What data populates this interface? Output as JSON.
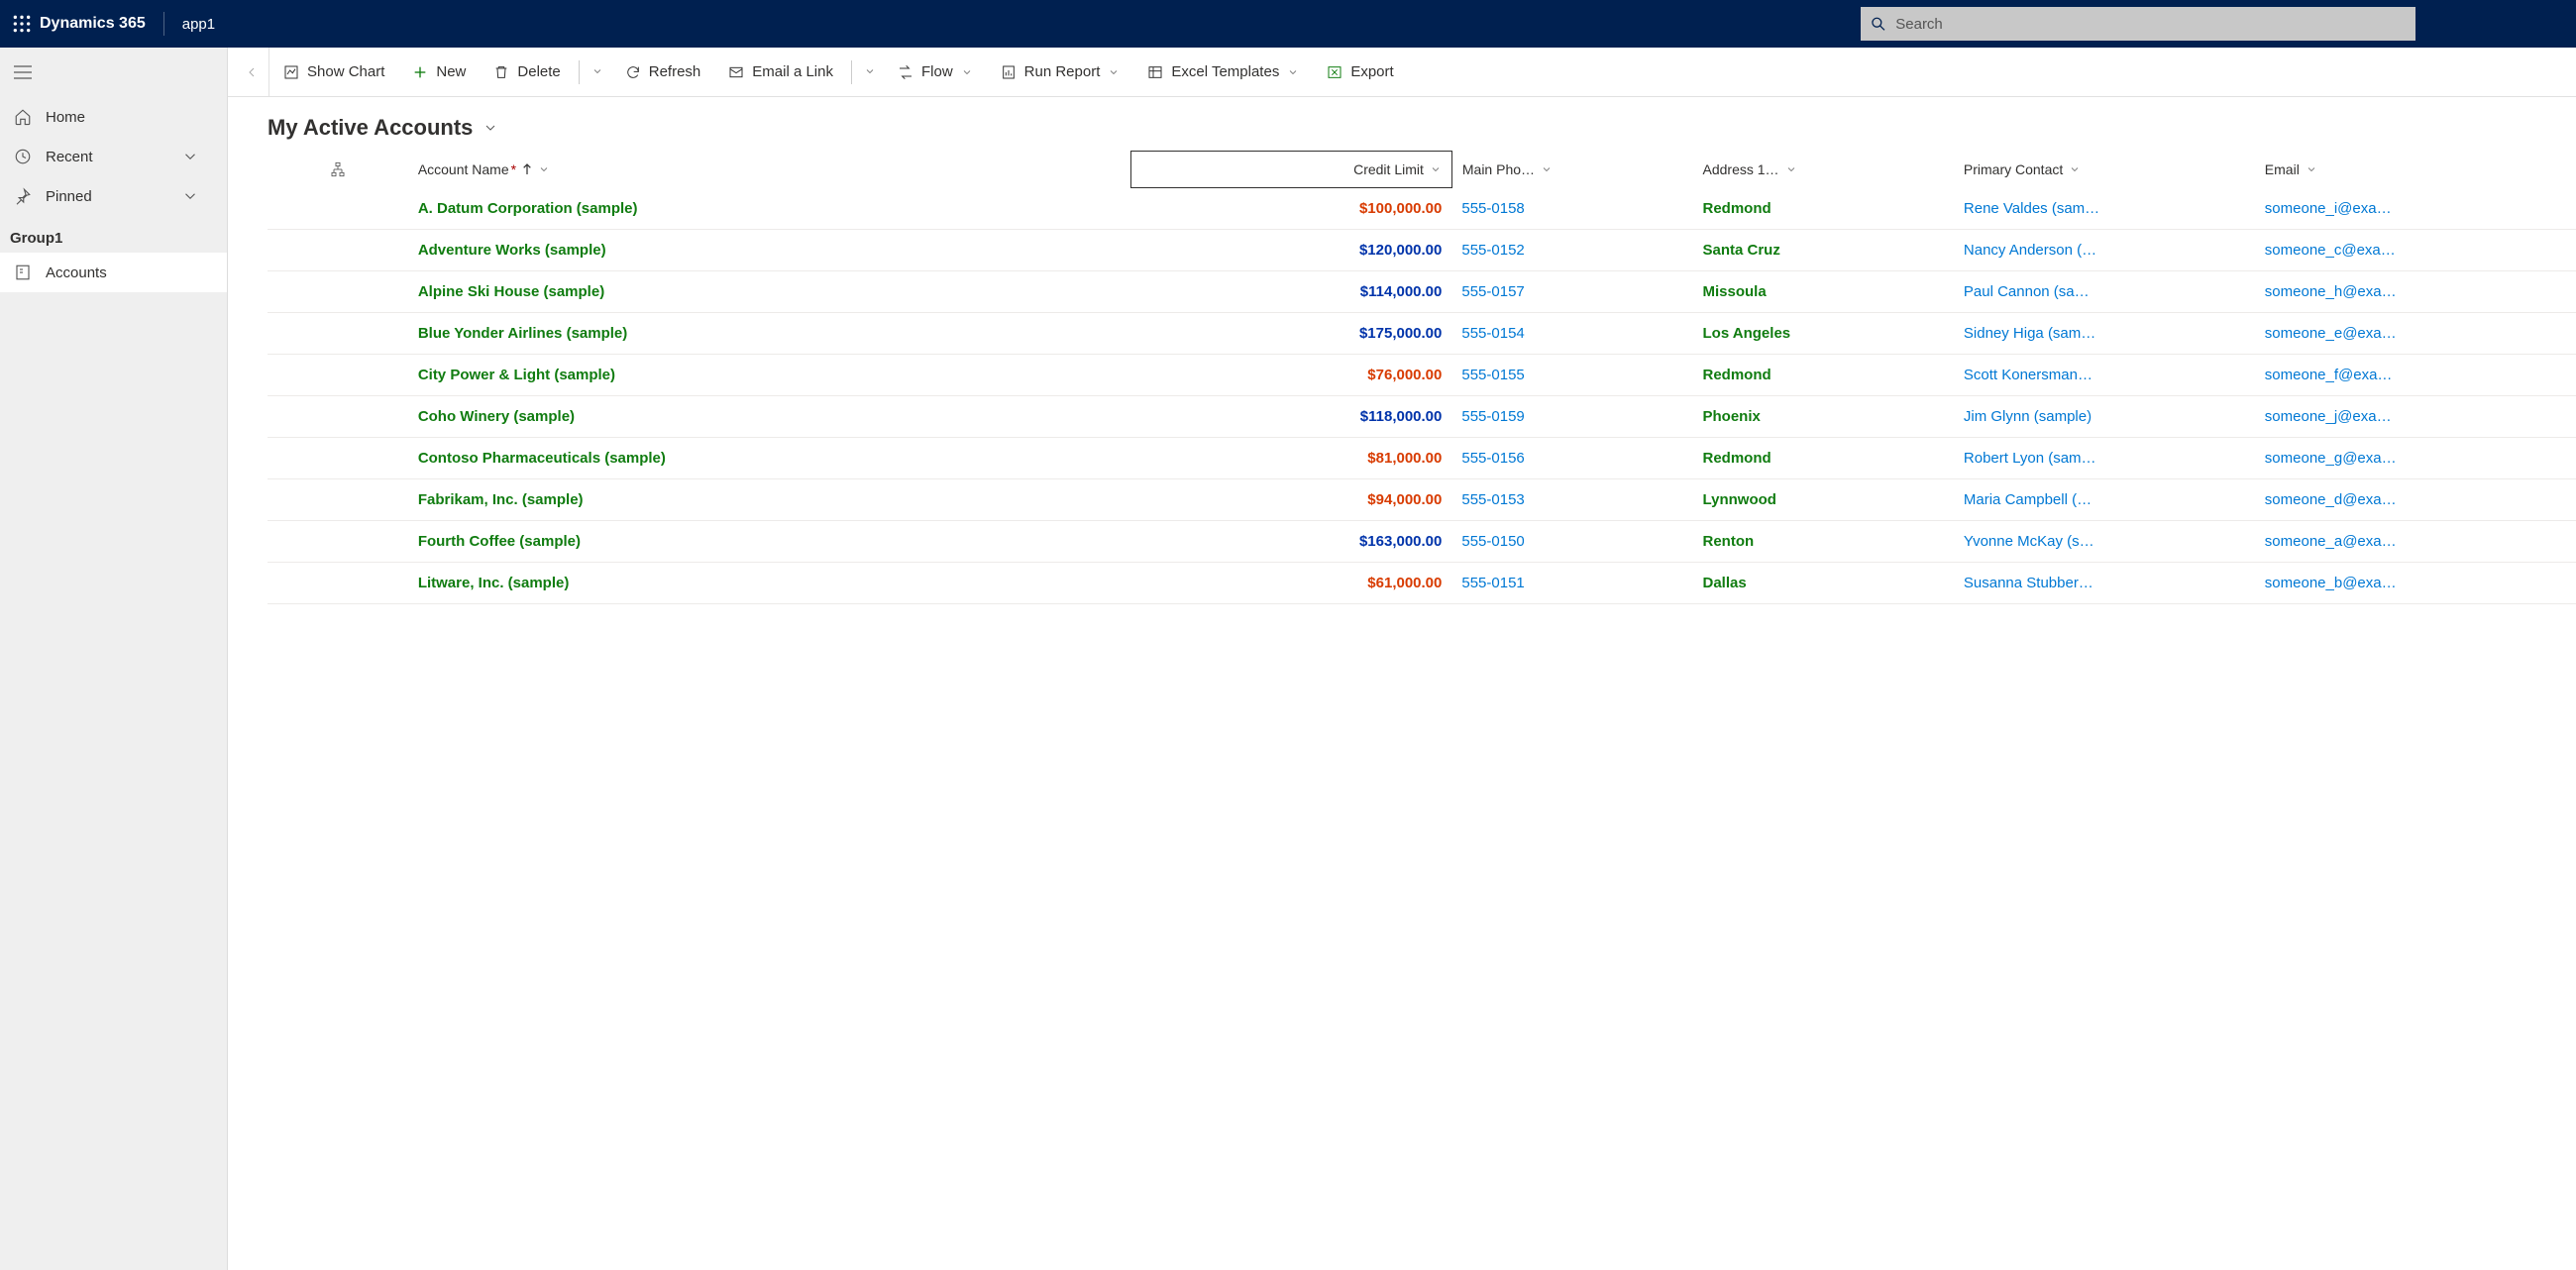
{
  "top": {
    "brand": "Dynamics 365",
    "app": "app1",
    "search_placeholder": "Search"
  },
  "sidebar": {
    "home": "Home",
    "recent": "Recent",
    "pinned": "Pinned",
    "group": "Group1",
    "accounts": "Accounts"
  },
  "cmd": {
    "showchart": "Show Chart",
    "new": "New",
    "delete": "Delete",
    "refresh": "Refresh",
    "email": "Email a Link",
    "flow": "Flow",
    "report": "Run Report",
    "templates": "Excel Templates",
    "export": "Export"
  },
  "view": {
    "title": "My Active Accounts"
  },
  "columns": {
    "name": "Account Name",
    "credit": "Credit Limit",
    "phone": "Main Pho…",
    "city": "Address 1…",
    "contact": "Primary Contact",
    "email": "Email"
  },
  "rows": [
    {
      "name": "A. Datum Corporation (sample)",
      "credit": "$100,000.00",
      "creditClass": "red",
      "phone": "555-0158",
      "city": "Redmond",
      "contact": "Rene Valdes (sam…",
      "email": "someone_i@exa…"
    },
    {
      "name": "Adventure Works (sample)",
      "credit": "$120,000.00",
      "creditClass": "blue",
      "phone": "555-0152",
      "city": "Santa Cruz",
      "contact": "Nancy Anderson (…",
      "email": "someone_c@exa…"
    },
    {
      "name": "Alpine Ski House (sample)",
      "credit": "$114,000.00",
      "creditClass": "blue",
      "phone": "555-0157",
      "city": "Missoula",
      "contact": "Paul Cannon (sa…",
      "email": "someone_h@exa…"
    },
    {
      "name": "Blue Yonder Airlines (sample)",
      "credit": "$175,000.00",
      "creditClass": "blue",
      "phone": "555-0154",
      "city": "Los Angeles",
      "contact": "Sidney Higa (sam…",
      "email": "someone_e@exa…"
    },
    {
      "name": "City Power & Light (sample)",
      "credit": "$76,000.00",
      "creditClass": "red",
      "phone": "555-0155",
      "city": "Redmond",
      "contact": "Scott Konersman…",
      "email": "someone_f@exa…"
    },
    {
      "name": "Coho Winery (sample)",
      "credit": "$118,000.00",
      "creditClass": "blue",
      "phone": "555-0159",
      "city": "Phoenix",
      "contact": "Jim Glynn (sample)",
      "email": "someone_j@exa…"
    },
    {
      "name": "Contoso Pharmaceuticals (sample)",
      "credit": "$81,000.00",
      "creditClass": "red",
      "phone": "555-0156",
      "city": "Redmond",
      "contact": "Robert Lyon (sam…",
      "email": "someone_g@exa…"
    },
    {
      "name": "Fabrikam, Inc. (sample)",
      "credit": "$94,000.00",
      "creditClass": "red",
      "phone": "555-0153",
      "city": "Lynnwood",
      "contact": "Maria Campbell (…",
      "email": "someone_d@exa…"
    },
    {
      "name": "Fourth Coffee (sample)",
      "credit": "$163,000.00",
      "creditClass": "blue",
      "phone": "555-0150",
      "city": "Renton",
      "contact": "Yvonne McKay (s…",
      "email": "someone_a@exa…"
    },
    {
      "name": "Litware, Inc. (sample)",
      "credit": "$61,000.00",
      "creditClass": "red",
      "phone": "555-0151",
      "city": "Dallas",
      "contact": "Susanna Stubber…",
      "email": "someone_b@exa…"
    }
  ]
}
